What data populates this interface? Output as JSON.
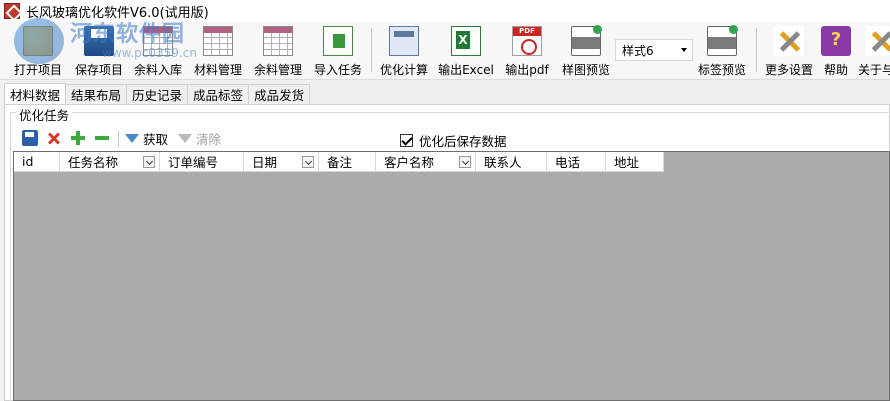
{
  "window": {
    "title": "长风玻璃优化软件V6.0(试用版)"
  },
  "toolbar": {
    "buttons": [
      {
        "label": "打开项目",
        "icon": "folder-icon"
      },
      {
        "label": "保存项目",
        "icon": "save-icon"
      },
      {
        "label": "余料入库",
        "icon": "inventory-icon"
      },
      {
        "label": "材料管理",
        "icon": "table-icon"
      },
      {
        "label": "余料管理",
        "icon": "table-icon"
      },
      {
        "label": "导入任务",
        "icon": "import-icon"
      },
      {
        "label": "优化计算",
        "icon": "calculator-icon"
      },
      {
        "label": "输出Excel",
        "icon": "excel-icon"
      },
      {
        "label": "输出pdf",
        "icon": "pdf-icon"
      },
      {
        "label": "样图预览",
        "icon": "printer-icon"
      },
      {
        "label": "标签预览",
        "icon": "printer-icon"
      },
      {
        "label": "更多设置",
        "icon": "tools-icon"
      },
      {
        "label": "帮助",
        "icon": "help-book-icon"
      },
      {
        "label": "关于与",
        "icon": "about-icon"
      }
    ],
    "style_select": {
      "value": "样式6"
    }
  },
  "watermark": {
    "text": "河东软件园",
    "url": "www.pc0359.cn"
  },
  "tabs": [
    {
      "label": "材料数据",
      "active": true
    },
    {
      "label": "结果布局",
      "active": false
    },
    {
      "label": "历史记录",
      "active": false
    },
    {
      "label": "成品标签",
      "active": false
    },
    {
      "label": "成品发货",
      "active": false
    }
  ],
  "task_group": {
    "title": "优化任务",
    "fetch_label": "获取",
    "clear_label": "清除",
    "save_after_optimize": {
      "label": "优化后保存数据",
      "checked": true
    }
  },
  "grid": {
    "columns": [
      {
        "label": "id",
        "filter": false
      },
      {
        "label": "任务名称",
        "filter": true
      },
      {
        "label": "订单编号",
        "filter": false
      },
      {
        "label": "日期",
        "filter": true
      },
      {
        "label": "备注",
        "filter": false
      },
      {
        "label": "客户名称",
        "filter": true
      },
      {
        "label": "联系人",
        "filter": false
      },
      {
        "label": "电话",
        "filter": false
      },
      {
        "label": "地址",
        "filter": false
      }
    ],
    "background_color": "#ababab"
  }
}
